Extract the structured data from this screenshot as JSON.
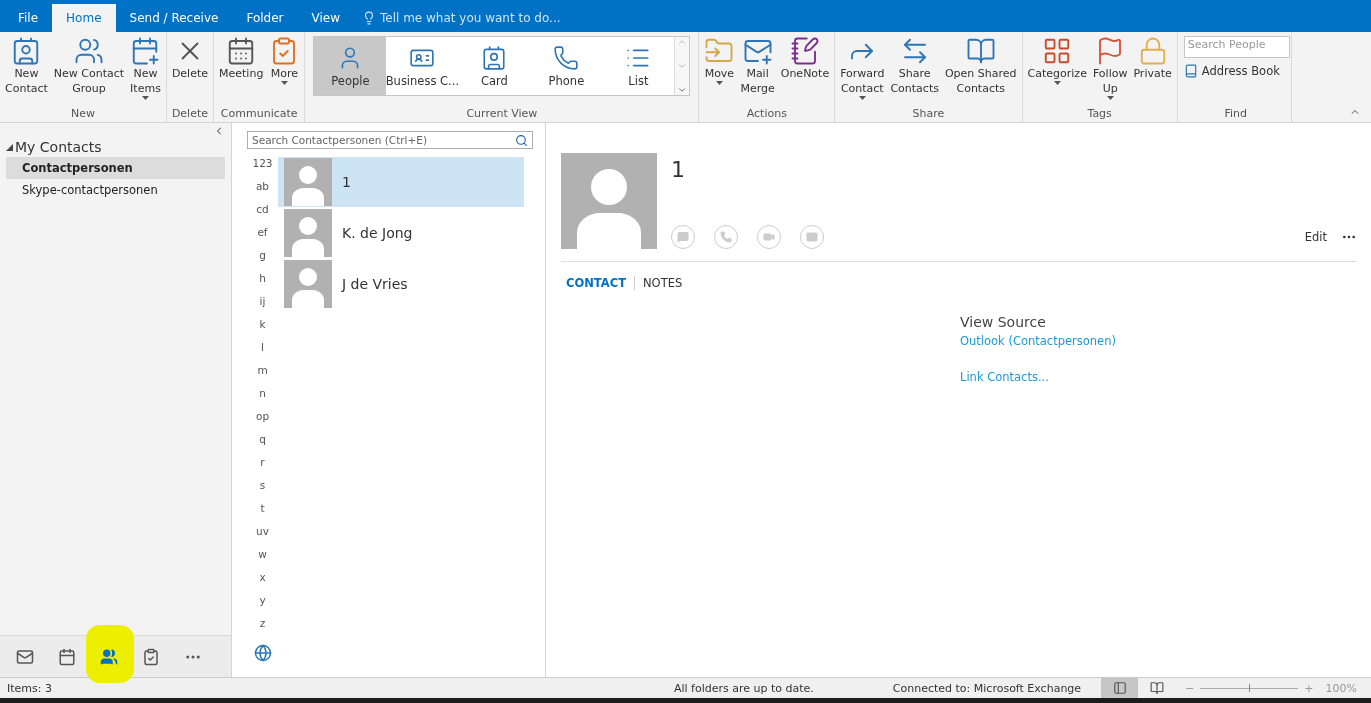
{
  "tabs": [
    {
      "label": "File",
      "selected": false
    },
    {
      "label": "Home",
      "selected": true
    },
    {
      "label": "Send / Receive",
      "selected": false
    },
    {
      "label": "Folder",
      "selected": false
    },
    {
      "label": "View",
      "selected": false
    }
  ],
  "tell_me": {
    "placeholder": "Tell me what you want to do..."
  },
  "ribbon": {
    "groups": [
      {
        "label": "New",
        "kind": "buttons",
        "buttons": [
          {
            "lines": [
              "New",
              "Contact"
            ],
            "dropdown": false
          },
          {
            "lines": [
              "New Contact",
              "Group"
            ],
            "dropdown": false
          },
          {
            "lines": [
              "New",
              "Items"
            ],
            "dropdown": true
          }
        ]
      },
      {
        "label": "Delete",
        "kind": "buttons",
        "buttons": [
          {
            "lines": [
              "Delete"
            ],
            "dropdown": false
          }
        ]
      },
      {
        "label": "Communicate",
        "kind": "buttons",
        "buttons": [
          {
            "lines": [
              "Meeting"
            ],
            "dropdown": false
          },
          {
            "lines": [
              "More"
            ],
            "dropdown": true
          }
        ]
      },
      {
        "label": "Current View",
        "kind": "gallery",
        "items": [
          {
            "label": "People",
            "selected": true
          },
          {
            "label": "Business C...",
            "selected": false
          },
          {
            "label": "Card",
            "selected": false
          },
          {
            "label": "Phone",
            "selected": false
          },
          {
            "label": "List",
            "selected": false
          }
        ]
      },
      {
        "label": "Actions",
        "kind": "buttons",
        "buttons": [
          {
            "lines": [
              "Move"
            ],
            "dropdown": true
          },
          {
            "lines": [
              "Mail",
              "Merge"
            ],
            "dropdown": false
          },
          {
            "lines": [
              "OneNote"
            ],
            "dropdown": false
          }
        ]
      },
      {
        "label": "Share",
        "kind": "buttons",
        "buttons": [
          {
            "lines": [
              "Forward",
              "Contact"
            ],
            "dropdown": true
          },
          {
            "lines": [
              "Share",
              "Contacts"
            ],
            "dropdown": false
          },
          {
            "lines": [
              "Open Shared",
              "Contacts"
            ],
            "dropdown": false
          }
        ]
      },
      {
        "label": "Tags",
        "kind": "buttons",
        "buttons": [
          {
            "lines": [
              "Categorize"
            ],
            "dropdown": true
          },
          {
            "lines": [
              "Follow",
              "Up"
            ],
            "dropdown": true
          },
          {
            "lines": [
              "Private"
            ],
            "dropdown": false
          }
        ]
      },
      {
        "label": "Find",
        "kind": "find",
        "search_placeholder": "Search People",
        "address_book": "Address Book"
      }
    ]
  },
  "folders": {
    "title": "My Contacts",
    "expanded": true,
    "children": [
      {
        "label": "Contactpersonen",
        "selected": true
      },
      {
        "label": "Skype-contactpersonen",
        "selected": false
      }
    ]
  },
  "nav": [
    {
      "selected": false,
      "highlighted": false
    },
    {
      "selected": false,
      "highlighted": false
    },
    {
      "selected": true,
      "highlighted": true
    },
    {
      "selected": false,
      "highlighted": false
    },
    {
      "selected": false,
      "highlighted": false
    }
  ],
  "search": {
    "placeholder": "Search Contactpersonen (Ctrl+E)"
  },
  "index": [
    "123",
    "ab",
    "cd",
    "ef",
    "g",
    "h",
    "ij",
    "k",
    "l",
    "m",
    "n",
    "op",
    "q",
    "r",
    "s",
    "t",
    "uv",
    "w",
    "x",
    "y",
    "z"
  ],
  "contacts": [
    {
      "name": "1",
      "selected": true
    },
    {
      "name": "K. de Jong",
      "selected": false
    },
    {
      "name": "J de Vries",
      "selected": false
    }
  ],
  "detail": {
    "name": "1",
    "edit": "Edit",
    "tabs": [
      {
        "label": "CONTACT",
        "selected": true
      },
      {
        "label": "NOTES",
        "selected": false
      }
    ],
    "source_title": "View Source",
    "source_link": "Outlook (Contactpersonen)",
    "link_contacts": "Link Contacts..."
  },
  "status": {
    "items": "Items: 3",
    "sync": "All folders are up to date.",
    "connection": "Connected to: Microsoft Exchange",
    "views": [
      {
        "selected": true
      },
      {
        "selected": false
      }
    ],
    "zoom": {
      "out": "−",
      "in": "+",
      "level": 0.5,
      "reading": "100%"
    }
  }
}
